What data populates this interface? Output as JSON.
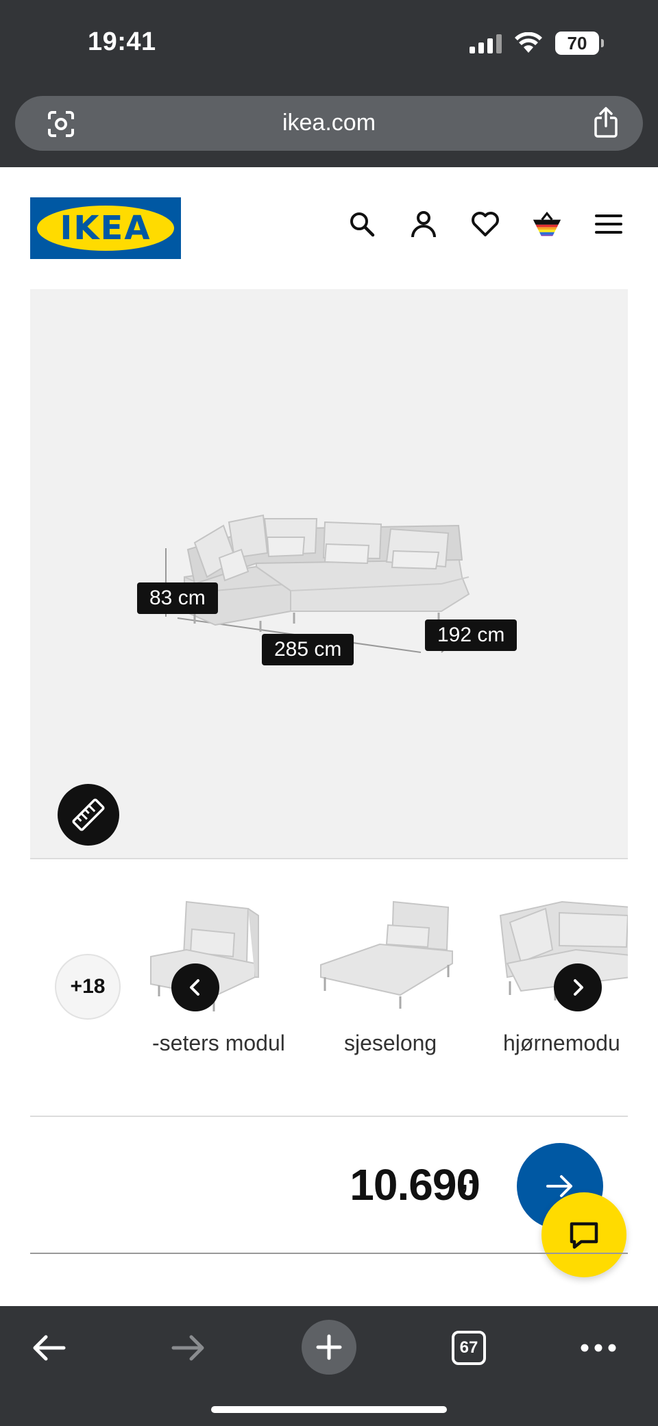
{
  "status_bar": {
    "time": "19:41",
    "battery": "70",
    "icons": [
      "signal-icon",
      "wifi-icon",
      "battery-icon"
    ]
  },
  "browser": {
    "url": "ikea.com",
    "left_icon": "lens-search-icon",
    "right_icon": "share-icon",
    "tab_count": "67"
  },
  "header": {
    "logo_text": "IKEA",
    "icons": [
      "search-icon",
      "account-icon",
      "heart-icon",
      "basket-icon",
      "menu-icon"
    ]
  },
  "product_image": {
    "dimensions": {
      "height": "83 cm",
      "width": "285 cm",
      "depth": "192 cm"
    },
    "measure_icon": "ruler-icon"
  },
  "thumbnails": {
    "more_count": "+18",
    "items": [
      {
        "label": "-seters modul"
      },
      {
        "label": "sjeselong"
      },
      {
        "label": "hjørnemodu"
      }
    ]
  },
  "price": {
    "amount": "10.690",
    "suffix": ",-"
  },
  "colors": {
    "ikea_blue": "#0058a3",
    "ikea_yellow": "#ffdb00",
    "chrome_dark": "#333538"
  }
}
